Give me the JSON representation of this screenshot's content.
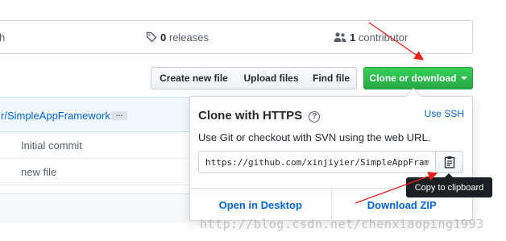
{
  "summary": {
    "branches_suffix": "h",
    "releases_count": "0",
    "releases_label": "releases",
    "contributors_count": "1",
    "contributors_label": "contributor"
  },
  "file_navigation": {
    "create_new_file": "Create new file",
    "upload_files": "Upload files",
    "find_file": "Find file",
    "clone_or_download": "Clone or download"
  },
  "file_list": {
    "repo_path": "r/SimpleAppFramework",
    "ellipsis": "…",
    "rows": [
      {
        "message": "Initial commit"
      },
      {
        "message": "new file"
      }
    ]
  },
  "clone_popover": {
    "title": "Clone with HTTPS",
    "help_glyph": "?",
    "use_ssh": "Use SSH",
    "description": "Use Git or checkout with SVN using the web URL.",
    "url": "https://github.com/xinjiyier/SimpleAppFramework.git",
    "open_in_desktop": "Open in Desktop",
    "download_zip": "Download ZIP"
  },
  "tooltip": {
    "copy_to_clipboard": "Copy to clipboard"
  },
  "watermark": "http://blog.csdn.net/chenxiaoping1993",
  "colors": {
    "clone_button": "#28a745",
    "link": "#0366d6",
    "tooltip_bg": "#1b1f23",
    "annotation_arrow": "#e8211a"
  },
  "icons": [
    "tag-icon",
    "people-icon",
    "help-icon",
    "clipboard-icon",
    "caret-down-icon"
  ]
}
